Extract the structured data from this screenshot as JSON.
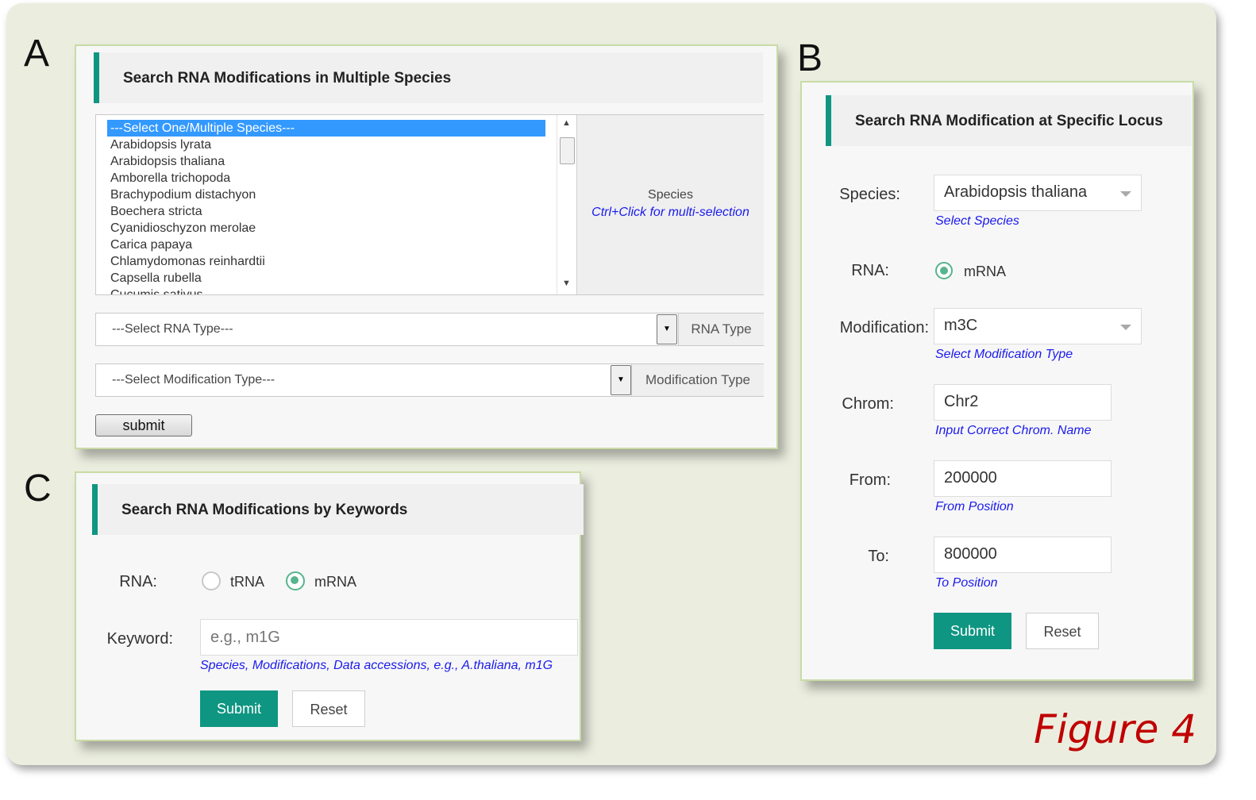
{
  "panel_letters": {
    "a": "A",
    "b": "B",
    "c": "C"
  },
  "panel_a": {
    "title": "Search RNA Modifications in Multiple Species",
    "species_options": [
      "---Select One/Multiple Species---",
      "Arabidopsis lyrata",
      "Arabidopsis thaliana",
      "Amborella trichopoda",
      "Brachypodium distachyon",
      "Boechera stricta",
      "Cyanidioschyzon merolae",
      "Carica papaya",
      "Chlamydomonas reinhardtii",
      "Capsella rubella",
      "Cucumis sativus"
    ],
    "species_label": "Species",
    "species_hint": "Ctrl+Click for multi-selection",
    "rna_type_select": "---Select RNA Type---",
    "rna_type_addon": "RNA Type",
    "mod_type_select": "---Select Modification Type---",
    "mod_type_addon": "Modification Type",
    "submit_label": "submit"
  },
  "panel_b": {
    "title": "Search RNA Modification at Specific Locus",
    "species_label": "Species:",
    "species_value": "Arabidopsis thaliana",
    "species_hint": "Select Species",
    "rna_label": "RNA:",
    "rna_option": "mRNA",
    "modification_label": "Modification:",
    "modification_value": "m3C",
    "modification_hint": "Select Modification Type",
    "chrom_label": "Chrom:",
    "chrom_value": "Chr2",
    "chrom_hint": "Input Correct Chrom. Name",
    "from_label": "From:",
    "from_value": "200000",
    "from_hint": "From Position",
    "to_label": "To:",
    "to_value": "800000",
    "to_hint": "To Position",
    "submit_label": "Submit",
    "reset_label": "Reset"
  },
  "panel_c": {
    "title": "Search RNA Modifications by Keywords",
    "rna_label": "RNA:",
    "rna_options": [
      "tRNA",
      "mRNA"
    ],
    "rna_selected": "mRNA",
    "keyword_label": "Keyword:",
    "keyword_placeholder": "e.g., m1G",
    "keyword_hint": "Species, Modifications, Data accessions, e.g., A.thaliana, m1G",
    "submit_label": "Submit",
    "reset_label": "Reset"
  },
  "figure_label": "Figure 4",
  "colors": {
    "accent": "#0f9682",
    "hint": "#1a1aee",
    "figure_label": "#c00000",
    "selected_option": "#3399ff"
  }
}
